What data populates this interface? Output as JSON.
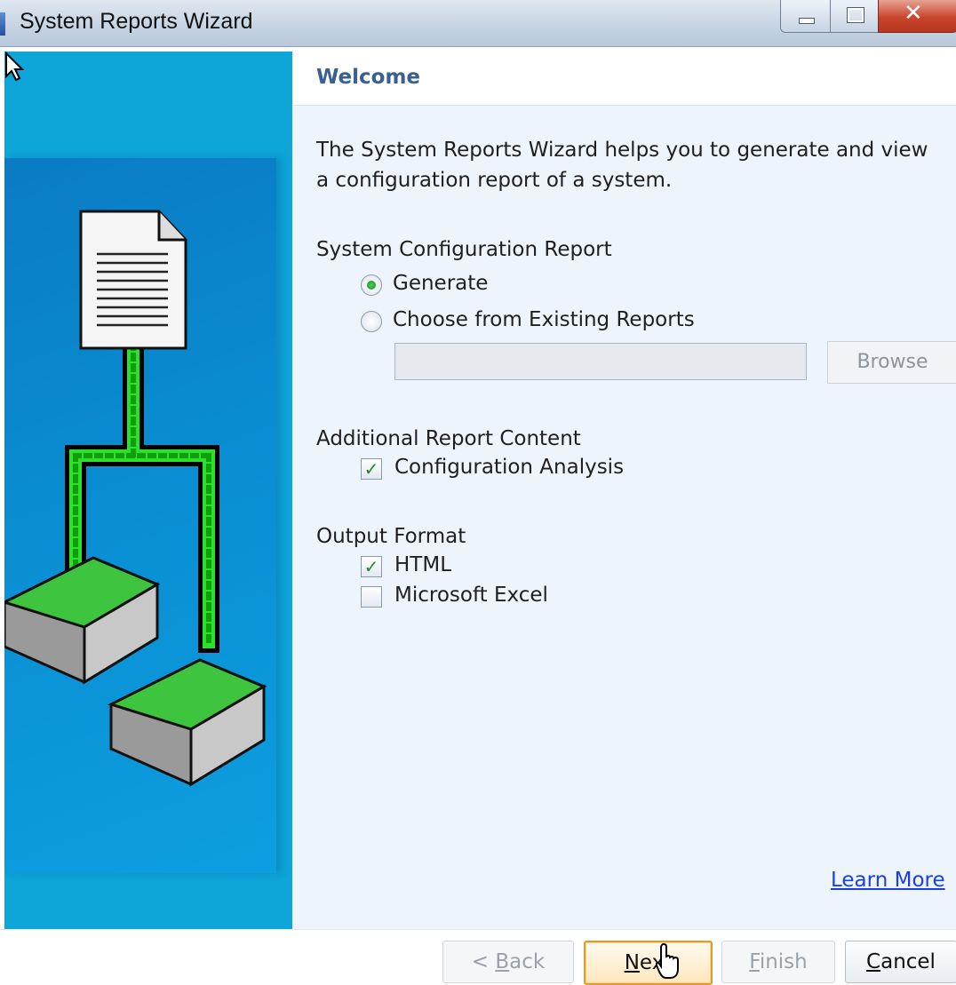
{
  "window": {
    "title": "System Reports Wizard",
    "controls": [
      "minimize",
      "maximize",
      "close"
    ]
  },
  "header": {
    "title": "Welcome"
  },
  "intro_text": "The System Reports Wizard helps you to generate and view a configuration report of a system.",
  "system_config": {
    "label": "System Configuration Report",
    "options": [
      {
        "label": "Generate",
        "selected": true
      },
      {
        "label": "Choose from Existing Reports",
        "selected": false
      }
    ],
    "path_value": "",
    "browse_label": "Browse"
  },
  "additional": {
    "label": "Additional Report Content",
    "items": [
      {
        "label": "Configuration Analysis",
        "checked": true
      }
    ]
  },
  "output_format": {
    "label": "Output Format",
    "items": [
      {
        "label": "HTML",
        "checked": true
      },
      {
        "label": "Microsoft Excel",
        "checked": false
      }
    ]
  },
  "learn_more": "Learn More",
  "buttons": {
    "back": {
      "prefix": "< ",
      "mnemonic": "B",
      "rest": "ack",
      "enabled": false
    },
    "next": {
      "mnemonic": "N",
      "rest": "ext",
      "enabled": true
    },
    "finish": {
      "mnemonic": "F",
      "rest": "inish",
      "enabled": false
    },
    "cancel": {
      "mnemonic": "C",
      "rest": "ancel",
      "enabled": true
    }
  },
  "colors": {
    "panel_blue": "#0ea5d9",
    "header_text": "#3a5f91",
    "link": "#1a3fe0",
    "check_green": "#1e8b2a"
  }
}
